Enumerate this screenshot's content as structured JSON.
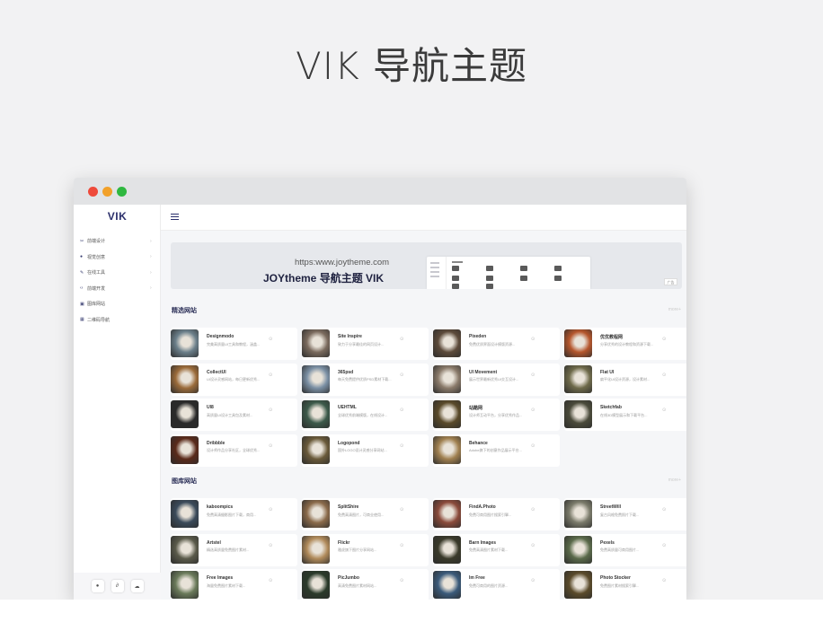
{
  "hero": {
    "title": "VIK 导航主题"
  },
  "app": {
    "logo": "VIK",
    "nav": [
      {
        "icon": "scissors-icon",
        "glyph": "✂",
        "label": "前端设计"
      },
      {
        "icon": "drop-icon",
        "glyph": "●",
        "label": "视觉创意"
      },
      {
        "icon": "pen-icon",
        "glyph": "✎",
        "label": "在线工具"
      },
      {
        "icon": "code-icon",
        "glyph": "‹›",
        "label": "前端开发"
      },
      {
        "icon": "image-icon",
        "glyph": "▣",
        "label": "图库网站"
      },
      {
        "icon": "qrcode-icon",
        "glyph": "▦",
        "label": "二维码导航"
      }
    ],
    "nav_chevron": "›",
    "bottom_buttons": [
      {
        "icon": "bell-icon",
        "glyph": "●"
      },
      {
        "icon": "link-icon",
        "glyph": "∂"
      },
      {
        "icon": "wechat-icon",
        "glyph": "☁"
      }
    ]
  },
  "banner": {
    "url": "https:www.joytheme.com",
    "title": "JOYtheme 导航主题 VIK",
    "ad_label": "广告"
  },
  "sections": [
    {
      "title": "精选网站",
      "more": "more+",
      "sites": [
        {
          "name": "Designmodo",
          "desc": "完美高质量UI工具和教程，涵盖...",
          "color": "#6b7f8a"
        },
        {
          "name": "Site Inspire",
          "desc": "致力于分享最佳的网页设计...",
          "color": "#7a6a5d"
        },
        {
          "name": "Pixeden",
          "desc": "免费优质界面设计模版资源...",
          "color": "#5c4a3a"
        },
        {
          "name": "优优教程网",
          "desc": "分享优秀的设计教程和资源下载...",
          "color": "#b5562c"
        },
        {
          "name": "CollectUI",
          "desc": "UI设计灵感网站，每日更新优秀...",
          "color": "#9b6b3a"
        },
        {
          "name": "365psd",
          "desc": "每天免费提供优质PSD素材下载...",
          "color": "#7a8fa4"
        },
        {
          "name": "UI Movement",
          "desc": "展示世界最新优秀UI交互设计...",
          "color": "#8a7a6a"
        },
        {
          "name": "Flat UI",
          "desc": "扁平化UI设计资源，设计素材...",
          "color": "#6e6a4a"
        },
        {
          "name": "UI8",
          "desc": "高质量UI设计工具包及素材...",
          "color": "#2a2a2a"
        },
        {
          "name": "UEHTML",
          "desc": "全球优秀前端模版，在线设计...",
          "color": "#3c5a4a"
        },
        {
          "name": "站酷网",
          "desc": "设计师互动平台，分享优秀作品...",
          "color": "#5a4a2a"
        },
        {
          "name": "Sketchfab",
          "desc": "在线3D模型展示和下载平台...",
          "color": "#4a4a3a"
        },
        {
          "name": "Dribbble",
          "desc": "设计师作品分享社区，全球优秀...",
          "color": "#5a2a1a"
        },
        {
          "name": "Logopond",
          "desc": "国外LOGO设计灵感分享网站...",
          "color": "#6a5a3a"
        },
        {
          "name": "Behance",
          "desc": "Adobe旗下的创意作品展示平台...",
          "color": "#a08050"
        }
      ]
    },
    {
      "title": "图库网站",
      "more": "more+",
      "sites": [
        {
          "name": "kaboompics",
          "desc": "免费高清摄影图片下载，商用...",
          "color": "#3a4a5a"
        },
        {
          "name": "SplitShire",
          "desc": "免费高清图片，可商业使用...",
          "color": "#8a6a4a"
        },
        {
          "name": "FindA.Photo",
          "desc": "免费可商用图片搜索引擎...",
          "color": "#8a4a3a"
        },
        {
          "name": "StreetWill",
          "desc": "复古风格免费照片下载...",
          "color": "#7a7a6a"
        },
        {
          "name": "Artstel",
          "desc": "精选高质量免费图片素材...",
          "color": "#5a5a4a"
        },
        {
          "name": "Flickr",
          "desc": "雅虎旗下图片分享网站...",
          "color": "#b08a5a"
        },
        {
          "name": "Barn Images",
          "desc": "免费高清图片素材下载...",
          "color": "#3a3a2a"
        },
        {
          "name": "Pexels",
          "desc": "免费高质量可商用图片...",
          "color": "#5a6a4a"
        },
        {
          "name": "Free Images",
          "desc": "海量免费图片素材下载...",
          "color": "#6a7a5a"
        },
        {
          "name": "PicJumbo",
          "desc": "高清免费图片素材网站...",
          "color": "#2a3a2a"
        },
        {
          "name": "Im Free",
          "desc": "免费可商用的图片资源...",
          "color": "#3a5a7a"
        },
        {
          "name": "Photo Stocker",
          "desc": "免费图片素材搜索引擎...",
          "color": "#5a4a2a"
        }
      ]
    }
  ]
}
